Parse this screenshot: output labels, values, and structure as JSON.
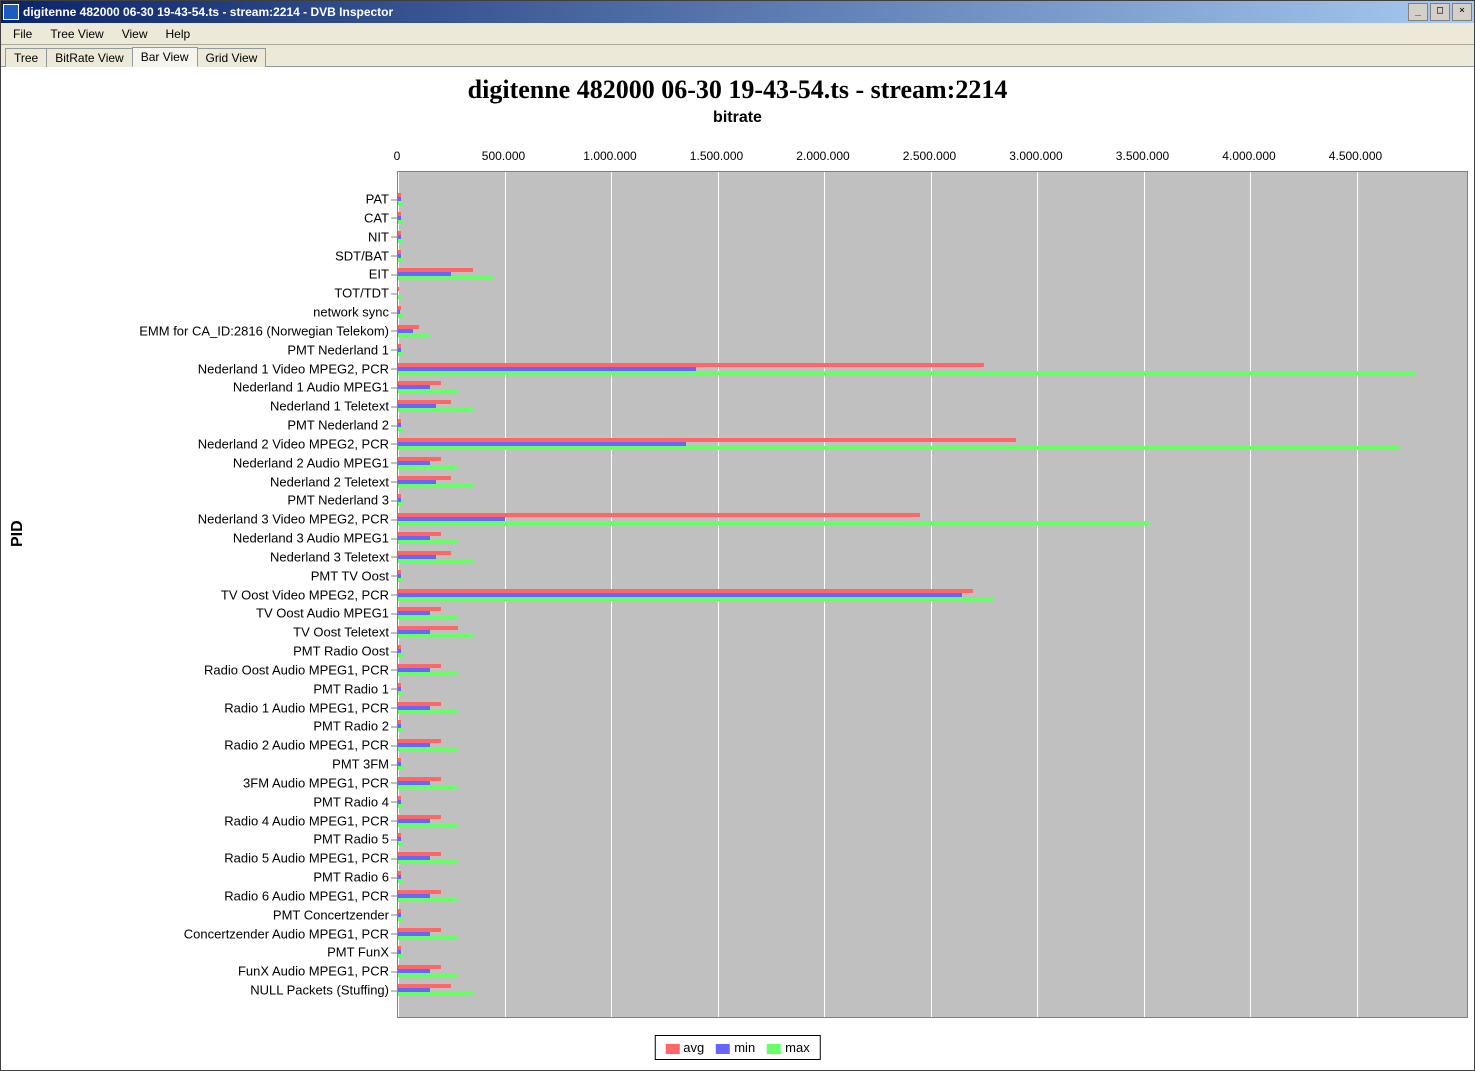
{
  "window": {
    "title": "digitenne 482000 06-30 19-43-54.ts - stream:2214 - DVB Inspector"
  },
  "menu": {
    "file": "File",
    "treeview": "Tree View",
    "view": "View",
    "help": "Help"
  },
  "tabs": {
    "tree": "Tree",
    "bitrate": "BitRate View",
    "bar": "Bar View",
    "grid": "Grid View"
  },
  "chart": {
    "title": "digitenne 482000 06-30 19-43-54.ts - stream:2214",
    "xaxis": "bitrate",
    "yaxis": "PID",
    "legend": {
      "avg": "avg",
      "min": "min",
      "max": "max"
    }
  },
  "chart_data": {
    "type": "bar",
    "xlabel": "bitrate",
    "ylabel": "PID",
    "xlim": [
      0,
      5000000
    ],
    "xticks": [
      0,
      500000,
      1000000,
      1500000,
      2000000,
      2500000,
      3000000,
      3500000,
      4000000,
      4500000
    ],
    "xtick_labels": [
      "0",
      "500.000",
      "1.000.000",
      "1.500.000",
      "2.000.000",
      "2.500.000",
      "3.000.000",
      "3.500.000",
      "4.000.000",
      "4.500.000"
    ],
    "series_names": [
      "avg",
      "min",
      "max"
    ],
    "categories": [
      "PAT",
      "CAT",
      "NIT",
      "SDT/BAT",
      "EIT",
      "TOT/TDT",
      "network sync",
      "EMM for CA_ID:2816 (Norwegian Telekom)",
      "PMT Nederland 1",
      "Nederland 1 Video MPEG2, PCR",
      "Nederland 1 Audio MPEG1",
      "Nederland 1 Teletext",
      "PMT Nederland 2",
      "Nederland 2 Video MPEG2, PCR",
      "Nederland 2 Audio MPEG1",
      "Nederland 2 Teletext",
      "PMT Nederland 3",
      "Nederland 3 Video MPEG2, PCR",
      "Nederland 3 Audio MPEG1",
      "Nederland 3 Teletext",
      "PMT TV Oost",
      "TV Oost Video MPEG2, PCR",
      "TV Oost Audio MPEG1",
      "TV Oost Teletext",
      "PMT Radio Oost",
      "Radio Oost Audio MPEG1, PCR",
      "PMT Radio 1",
      "Radio 1 Audio MPEG1, PCR",
      "PMT Radio 2",
      "Radio 2 Audio MPEG1, PCR",
      "PMT 3FM",
      "3FM Audio MPEG1, PCR",
      "PMT Radio 4",
      "Radio 4 Audio MPEG1, PCR",
      "PMT Radio 5",
      "Radio 5 Audio MPEG1, PCR",
      "PMT Radio 6",
      "Radio 6 Audio MPEG1, PCR",
      "PMT Concertzender",
      "Concertzender Audio MPEG1, PCR",
      "PMT FunX",
      "FunX Audio MPEG1, PCR",
      "NULL Packets (Stuffing)"
    ],
    "data": {
      "avg": [
        15000,
        15000,
        15000,
        15000,
        350000,
        5000,
        15000,
        100000,
        15000,
        2750000,
        200000,
        250000,
        15000,
        2900000,
        200000,
        250000,
        15000,
        2450000,
        200000,
        250000,
        15000,
        2700000,
        200000,
        280000,
        15000,
        200000,
        15000,
        200000,
        15000,
        200000,
        15000,
        200000,
        15000,
        200000,
        15000,
        200000,
        15000,
        200000,
        15000,
        200000,
        15000,
        200000,
        250000
      ],
      "min": [
        15000,
        15000,
        15000,
        15000,
        250000,
        0,
        10000,
        70000,
        15000,
        1400000,
        150000,
        180000,
        15000,
        1350000,
        150000,
        180000,
        15000,
        500000,
        150000,
        180000,
        15000,
        2650000,
        150000,
        150000,
        15000,
        150000,
        15000,
        150000,
        15000,
        150000,
        15000,
        150000,
        15000,
        150000,
        15000,
        150000,
        15000,
        150000,
        15000,
        150000,
        15000,
        150000,
        150000
      ],
      "max": [
        30000,
        30000,
        30000,
        30000,
        450000,
        20000,
        30000,
        150000,
        30000,
        4780000,
        280000,
        350000,
        30000,
        4700000,
        280000,
        350000,
        30000,
        3530000,
        280000,
        350000,
        30000,
        2800000,
        280000,
        350000,
        30000,
        280000,
        30000,
        280000,
        30000,
        280000,
        30000,
        280000,
        30000,
        280000,
        30000,
        280000,
        30000,
        280000,
        30000,
        280000,
        30000,
        280000,
        350000
      ]
    }
  }
}
